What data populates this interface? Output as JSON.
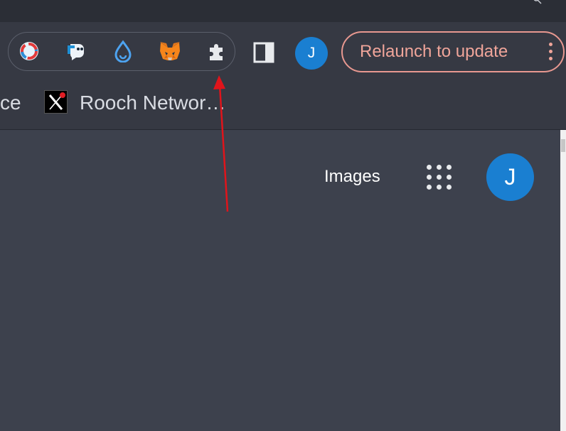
{
  "toolbar": {
    "extensions": [
      "colorful-ring-extension-icon",
      "ghost-extension-icon",
      "droplet-extension-icon",
      "metamask-fox-icon",
      "puzzle-piece-icon"
    ],
    "profile_initial": "J",
    "relaunch_label": "Relaunch to update"
  },
  "bookmarks": {
    "partial_left_text": "ce",
    "item_label": "Rooch Networ…"
  },
  "page": {
    "images_link": "Images",
    "avatar_initial": "J"
  },
  "colors": {
    "background": "#3d414d",
    "toolbar": "#363943",
    "relaunch_accent": "#f0a59a",
    "avatar_blue": "#1a7fd1",
    "annotation_arrow": "#e0141b"
  }
}
